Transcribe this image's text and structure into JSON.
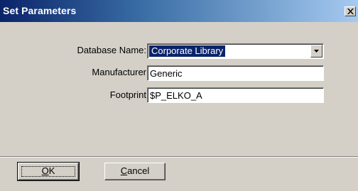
{
  "window": {
    "title": "Set Parameters"
  },
  "form": {
    "database": {
      "label": "Database Name:",
      "value": "Corporate Library"
    },
    "manufacturer": {
      "label": "Manufacturer",
      "value": "Generic"
    },
    "footprint": {
      "label": "Footprint",
      "value": "$P_ELKO_A"
    }
  },
  "buttons": {
    "ok": {
      "mnemonic": "O",
      "rest": "K"
    },
    "cancel": {
      "mnemonic": "C",
      "rest": "ancel"
    }
  },
  "icons": {
    "close": "close-icon",
    "dropdown": "chevron-down-icon"
  }
}
